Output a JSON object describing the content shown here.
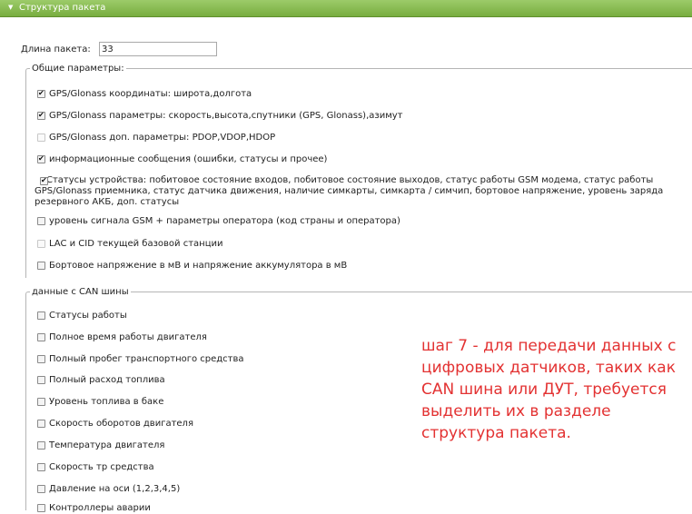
{
  "panel": {
    "title": "Структура пакета"
  },
  "packet_length": {
    "label": "Длина пакета:",
    "value": "33"
  },
  "general": {
    "legend": "Общие параметры:",
    "options": [
      {
        "label": "GPS/Glonass координаты: широта,долгота",
        "checked": true
      },
      {
        "label": "GPS/Glonass параметры: скорость,высота,спутники (GPS, Glonass),азимут",
        "checked": true
      },
      {
        "label": "GPS/Glonass доп. параметры: PDOP,VDOP,HDOP",
        "checked": false,
        "disabled": true
      },
      {
        "label": "информационные сообщения (ошибки, статусы и прочее)",
        "checked": true
      },
      {
        "label": "Статусы устройства: побитовое состояние входов, побитовое состояние выходов, статус работы GSM модема, статус работы GPS/Glonass приемника, статус датчика движения, наличие симкарты, симкарта / симчип, бортовое напряжение, уровень заряда резервного АКБ, доп. статусы",
        "checked": true
      },
      {
        "label": "уровень сигнала GSM + параметры оператора (код страны и оператора)",
        "checked": false
      },
      {
        "label": "LAC и CID текущей базовой станции",
        "checked": false,
        "disabled": true
      },
      {
        "label": "Бортовое напряжение в мВ и напряжение аккумулятора в мВ",
        "checked": false
      }
    ]
  },
  "can": {
    "legend": "данные с CAN шины",
    "options": [
      {
        "label": "Статусы работы",
        "checked": false
      },
      {
        "label": "Полное время работы двигателя",
        "checked": false
      },
      {
        "label": "Полный пробег транспортного средства",
        "checked": false
      },
      {
        "label": "Полный расход топлива",
        "checked": false
      },
      {
        "label": "Уровень топлива в баке",
        "checked": false
      },
      {
        "label": "Скорость оборотов двигателя",
        "checked": false
      },
      {
        "label": "Температура двигателя",
        "checked": false
      },
      {
        "label": "Скорость тр средства",
        "checked": false
      },
      {
        "label": "Давление на оси (1,2,3,4,5)",
        "checked": false
      },
      {
        "label": "Контроллеры аварии",
        "checked": false
      }
    ]
  },
  "note": "шаг 7 - для передачи данных с цифровых датчиков, таких как CAN шина или ДУТ, требуется выделить их в разделе структура пакета."
}
